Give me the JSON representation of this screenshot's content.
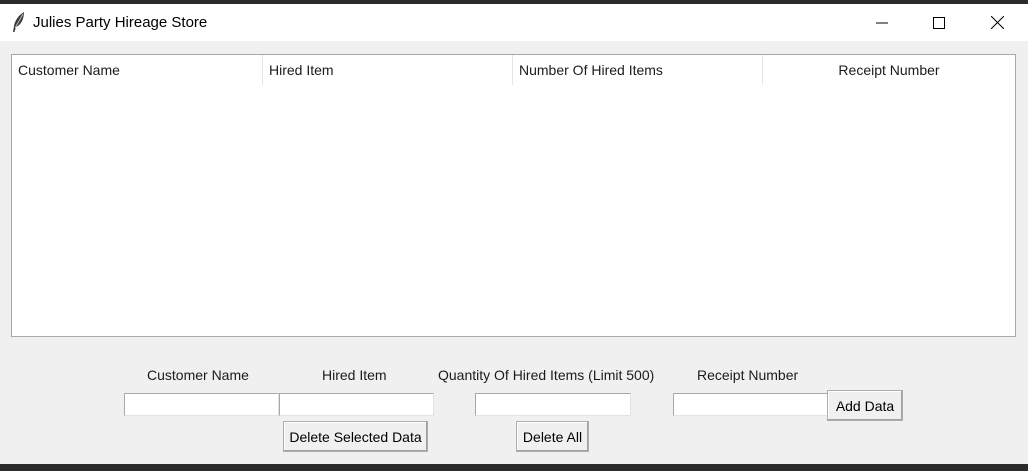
{
  "window": {
    "title": "Julies Party Hireage Store",
    "icon": "feather-icon"
  },
  "table": {
    "columns": [
      "Customer Name",
      "Hired Item",
      "Number Of Hired Items",
      "Receipt Number"
    ],
    "rows": []
  },
  "form": {
    "labels": {
      "customer_name": "Customer Name",
      "hired_item": "Hired Item",
      "quantity": "Quantity Of Hired Items (Limit 500)",
      "receipt_number": "Receipt Number"
    },
    "values": {
      "customer_name": "",
      "hired_item": "",
      "quantity": "",
      "receipt_number": ""
    }
  },
  "buttons": {
    "add": "Add Data",
    "delete_selected": "Delete Selected Data",
    "delete_all": "Delete All"
  }
}
